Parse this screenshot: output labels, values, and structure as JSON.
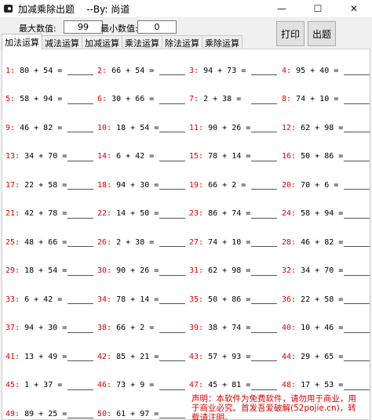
{
  "window": {
    "title": "加减乘除出题    --By: 尚道",
    "minimize_glyph": "—",
    "maximize_glyph": "☐",
    "close_glyph": "✕"
  },
  "toolbar": {
    "max_label": "最大数值:",
    "max_value": "99",
    "min_label": "最小数值:",
    "min_value": "0",
    "print_label": "打印",
    "generate_label": "出题"
  },
  "tabs": [
    "加法运算",
    "减法运算",
    "加减运算",
    "乘法运算",
    "除法运算",
    "乘除运算"
  ],
  "active_tab": 0,
  "problems": [
    {
      "n": "1",
      "expr": "80 + 54 ="
    },
    {
      "n": "2",
      "expr": "66 + 54 ="
    },
    {
      "n": "3",
      "expr": "94 + 73 ="
    },
    {
      "n": "4",
      "expr": "95 + 40 ="
    },
    {
      "n": "5",
      "expr": "58 + 94 ="
    },
    {
      "n": "6",
      "expr": "30 + 66 ="
    },
    {
      "n": "7",
      "expr": "2 + 38 ="
    },
    {
      "n": "8",
      "expr": "74 + 10 ="
    },
    {
      "n": "9",
      "expr": "46 + 82 ="
    },
    {
      "n": "10",
      "expr": "18 + 54 ="
    },
    {
      "n": "11",
      "expr": "90 + 26 ="
    },
    {
      "n": "12",
      "expr": "62 + 98 ="
    },
    {
      "n": "13",
      "expr": "34 + 70 ="
    },
    {
      "n": "14",
      "expr": "6 + 42 ="
    },
    {
      "n": "15",
      "expr": "78 + 14 ="
    },
    {
      "n": "16",
      "expr": "50 + 86 ="
    },
    {
      "n": "17",
      "expr": "22 + 58 ="
    },
    {
      "n": "18",
      "expr": "94 + 30 ="
    },
    {
      "n": "19",
      "expr": "66 + 2 ="
    },
    {
      "n": "20",
      "expr": "70 + 6 ="
    },
    {
      "n": "21",
      "expr": "42 + 78 ="
    },
    {
      "n": "22",
      "expr": "14 + 50 ="
    },
    {
      "n": "23",
      "expr": "86 + 74 ="
    },
    {
      "n": "24",
      "expr": "58 + 94 ="
    },
    {
      "n": "25",
      "expr": "48 + 66 ="
    },
    {
      "n": "26",
      "expr": "2 + 38 ="
    },
    {
      "n": "27",
      "expr": "74 + 10 ="
    },
    {
      "n": "28",
      "expr": "46 + 82 ="
    },
    {
      "n": "29",
      "expr": "18 + 54 ="
    },
    {
      "n": "30",
      "expr": "90 + 26 ="
    },
    {
      "n": "31",
      "expr": "62 + 98 ="
    },
    {
      "n": "32",
      "expr": "34 + 70 ="
    },
    {
      "n": "33",
      "expr": "6 + 42 ="
    },
    {
      "n": "34",
      "expr": "78 + 14 ="
    },
    {
      "n": "35",
      "expr": "50 + 86 ="
    },
    {
      "n": "36",
      "expr": "22 + 58 ="
    },
    {
      "n": "37",
      "expr": "94 + 30 ="
    },
    {
      "n": "38",
      "expr": "66 + 2 ="
    },
    {
      "n": "39",
      "expr": "38 + 74 ="
    },
    {
      "n": "40",
      "expr": "10 + 46 ="
    },
    {
      "n": "41",
      "expr": "13 + 49 ="
    },
    {
      "n": "42",
      "expr": "85 + 21 ="
    },
    {
      "n": "43",
      "expr": "57 + 93 ="
    },
    {
      "n": "44",
      "expr": "29 + 65 ="
    },
    {
      "n": "45",
      "expr": "1 + 37 ="
    },
    {
      "n": "46",
      "expr": "73 + 9 ="
    },
    {
      "n": "47",
      "expr": "45 + 81 ="
    },
    {
      "n": "48",
      "expr": "17 + 53 ="
    },
    {
      "n": "49",
      "expr": "89 + 25 ="
    },
    {
      "n": "50",
      "expr": "61 + 97 ="
    }
  ],
  "notice": "声明：本软件为免费软件，请勿用于商业，用于商业必究。首发吾爱破解(52pojie.cn)，转载请注明。",
  "colors": {
    "number": "#e00000",
    "notice": "#e00000",
    "panel_bg": "#ffffff",
    "window_bg": "#f0f0f0"
  }
}
